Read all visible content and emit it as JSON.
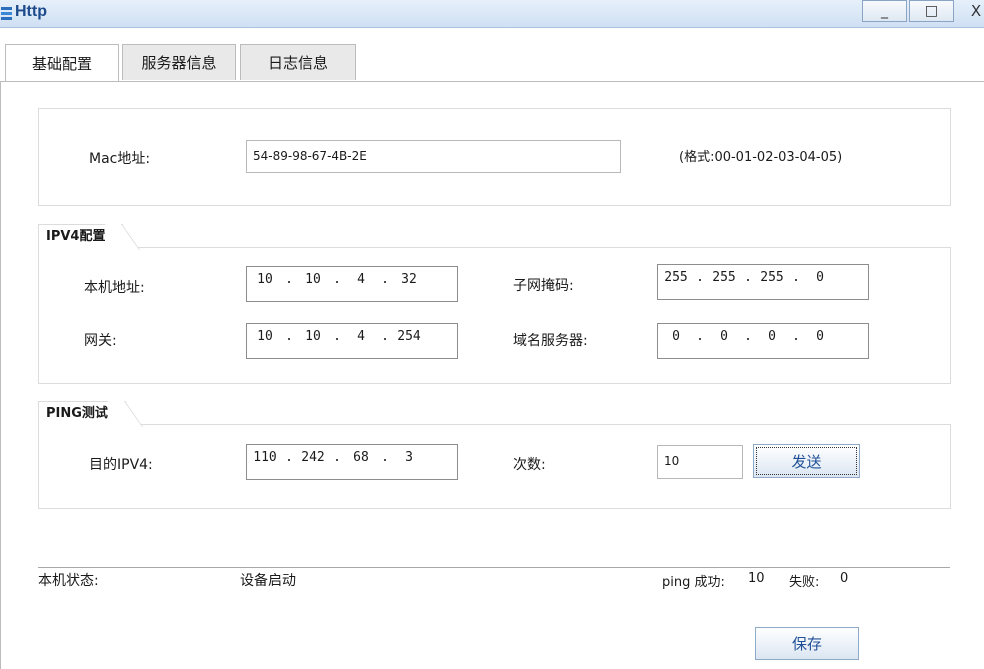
{
  "window": {
    "title": "Http",
    "min_label": "_",
    "max_label": "□",
    "close_label": "X"
  },
  "tabs": [
    {
      "label": "基础配置",
      "active": true
    },
    {
      "label": "服务器信息",
      "active": false
    },
    {
      "label": "日志信息",
      "active": false
    }
  ],
  "mac": {
    "label": "Mac地址:",
    "value": "54-89-98-67-4B-2E",
    "hint": "(格式:00-01-02-03-04-05)"
  },
  "ipv4": {
    "legend": "IPV4配置",
    "local_label": "本机地址:",
    "local_ip": [
      "10",
      "10",
      "4",
      "32"
    ],
    "mask_label": "子网掩码:",
    "mask_ip": [
      "255",
      "255",
      "255",
      "0"
    ],
    "gateway_label": "网关:",
    "gateway_ip": [
      "10",
      "10",
      "4",
      "254"
    ],
    "dns_label": "域名服务器:",
    "dns_ip": [
      "0",
      "0",
      "0",
      "0"
    ]
  },
  "ping": {
    "legend": "PING测试",
    "target_label": "目的IPV4:",
    "target_ip": [
      "110",
      "242",
      "68",
      "3"
    ],
    "count_label": "次数:",
    "count_value": "10",
    "send_label": "发送"
  },
  "status": {
    "label": "本机状态:",
    "value": "设备启动",
    "ping_success_label": "ping 成功:",
    "ping_success": "10",
    "ping_fail_label": "失败:",
    "ping_fail": "0"
  },
  "save_label": "保存"
}
